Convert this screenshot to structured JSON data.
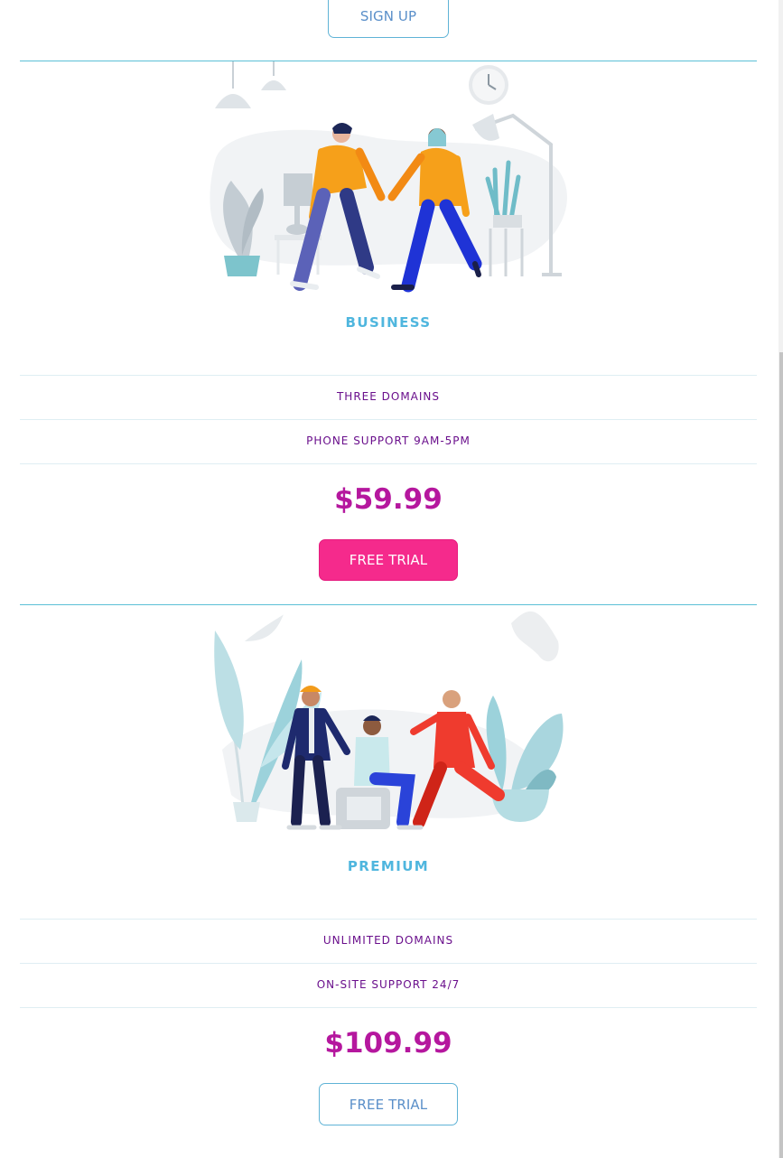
{
  "top": {
    "signup_label": "SIGN UP"
  },
  "plans": [
    {
      "title": "BUSINESS",
      "features": [
        "THREE DOMAINS",
        "PHONE SUPPORT 9AM-5PM"
      ],
      "price": "$59.99",
      "cta_label": "FREE TRIAL",
      "cta_style": "filled",
      "illustration": "two-people-dancing-illustration"
    },
    {
      "title": "PREMIUM",
      "features": [
        "UNLIMITED DOMAINS",
        "ON-SITE SUPPORT 24/7"
      ],
      "price": "$109.99",
      "cta_label": "FREE TRIAL",
      "cta_style": "outline",
      "illustration": "three-people-meeting-illustration"
    }
  ],
  "colors": {
    "accent_blue": "#4fb6de",
    "feature_purple": "#6a0f8c",
    "price_magenta": "#b5179e",
    "cta_pink": "#f52a8c"
  }
}
